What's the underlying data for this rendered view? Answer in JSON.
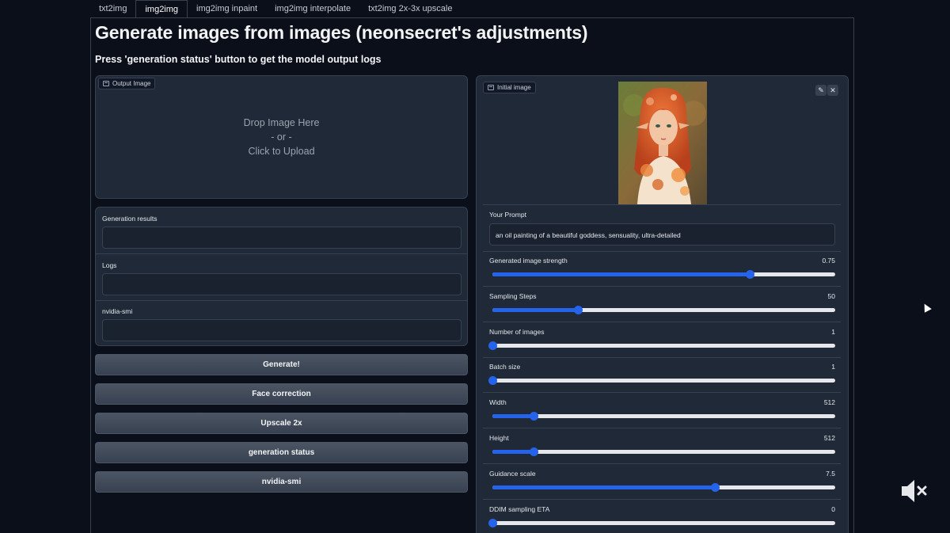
{
  "tabs": [
    {
      "label": "txt2img",
      "active": false
    },
    {
      "label": "img2img",
      "active": true
    },
    {
      "label": "img2img inpaint",
      "active": false
    },
    {
      "label": "img2img interpolate",
      "active": false
    },
    {
      "label": "txt2img 2x-3x upscale",
      "active": false
    }
  ],
  "header": {
    "title": "Generate images from images (neonsecret's adjustments)",
    "subtitle": "Press 'generation status' button to get the model output logs"
  },
  "output_image": {
    "label": "Output Image",
    "drop_line1": "Drop Image Here",
    "drop_line2": "- or -",
    "drop_line3": "Click to Upload"
  },
  "results": {
    "generation_results_label": "Generation results",
    "generation_results_value": "",
    "logs_label": "Logs",
    "logs_value": "",
    "nvidia_smi_label": "nvidia-smi",
    "nvidia_smi_value": ""
  },
  "buttons": {
    "generate": "Generate!",
    "face_correction": "Face correction",
    "upscale": "Upscale 2x",
    "generation_status": "generation status",
    "nvidia_smi": "nvidia-smi"
  },
  "initial_image": {
    "label": "Initial image",
    "image_icon": "portrait-painting",
    "edit_icon": "pencil-icon",
    "close_icon": "close-icon"
  },
  "prompt": {
    "label": "Your Prompt",
    "value": "an oil painting of a beautiful goddess, sensuality, ultra-detailed"
  },
  "sliders": [
    {
      "label": "Generated image strength",
      "value": "0.75",
      "fraction": 0.75
    },
    {
      "label": "Sampling Steps",
      "value": "50",
      "fraction": 0.25
    },
    {
      "label": "Number of images",
      "value": "1",
      "fraction": 0.0
    },
    {
      "label": "Batch size",
      "value": "1",
      "fraction": 0.0
    },
    {
      "label": "Width",
      "value": "512",
      "fraction": 0.12
    },
    {
      "label": "Height",
      "value": "512",
      "fraction": 0.12
    },
    {
      "label": "Guidance scale",
      "value": "7.5",
      "fraction": 0.65
    },
    {
      "label": "DDIM sampling ETA",
      "value": "0",
      "fraction": 0.0
    }
  ],
  "overlay": {
    "mute_icon": "speaker-muted-icon",
    "cursor_icon": "mouse-pointer-icon"
  },
  "colors": {
    "background": "#0b0f19",
    "panel": "#1f2937",
    "border": "#374151",
    "accent": "#2563eb"
  }
}
